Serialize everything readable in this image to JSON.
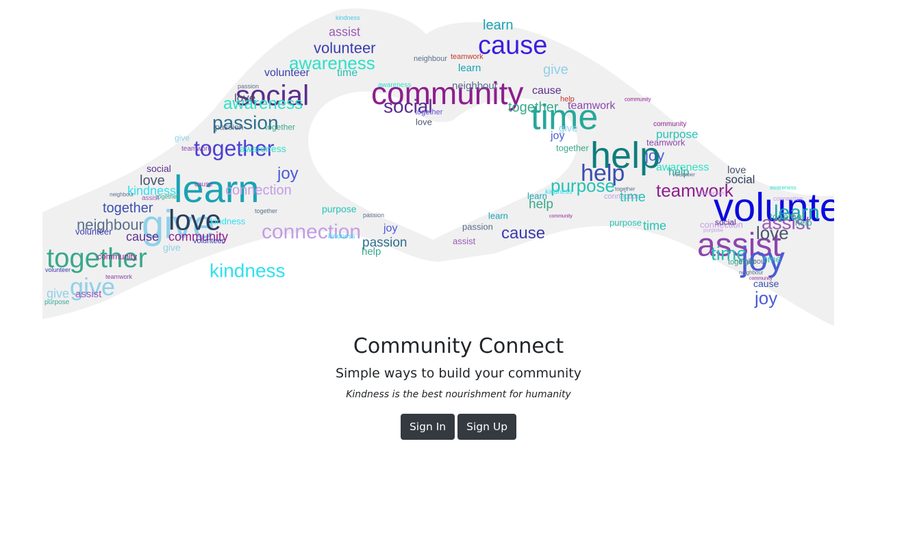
{
  "hero": {
    "image_alt": "Word cloud shaped like two hands forming a heart",
    "background_color": "#f0f0f0",
    "words": [
      {
        "text": "kindness",
        "color": "#48c9e6",
        "size": 9
      },
      {
        "text": "assist",
        "color": "#9b59b6",
        "size": 18
      },
      {
        "text": "volunteer",
        "color": "#3b3bb0",
        "size": 22
      },
      {
        "text": "awareness",
        "color": "#2fe0c6",
        "size": 26
      },
      {
        "text": "neighbour",
        "color": "#5a6e8c",
        "size": 11
      },
      {
        "text": "volunteer",
        "color": "#3b3bb0",
        "size": 16
      },
      {
        "text": "time",
        "color": "#26c2b5",
        "size": 16
      },
      {
        "text": "social",
        "color": "#5b2d8e",
        "size": 42
      },
      {
        "text": "community",
        "color": "#8e1e8e",
        "size": 46
      },
      {
        "text": "awareness",
        "color": "#2fe0c6",
        "size": 10
      },
      {
        "text": "social",
        "color": "#5b2d8e",
        "size": 28
      },
      {
        "text": "passion",
        "color": "#5a6e8c",
        "size": 9
      },
      {
        "text": "love",
        "color": "#4a5570",
        "size": 17
      },
      {
        "text": "awareness",
        "color": "#2fe0c6",
        "size": 24
      },
      {
        "text": "passion",
        "color": "#2e6f8e",
        "size": 28
      },
      {
        "text": "together",
        "color": "#5e50d8",
        "size": 11
      },
      {
        "text": "love",
        "color": "#4a5570",
        "size": 13
      },
      {
        "text": "passion",
        "color": "#5a6e8c",
        "size": 12
      },
      {
        "text": "together",
        "color": "#3aa88a",
        "size": 12
      },
      {
        "text": "together",
        "color": "#4a3fd6",
        "size": 32
      },
      {
        "text": "give",
        "color": "#90d0ea",
        "size": 12
      },
      {
        "text": "teamwork",
        "color": "#8e44ad",
        "size": 10
      },
      {
        "text": "learn",
        "color": "#19a3b4",
        "size": 56
      },
      {
        "text": "awareness",
        "color": "#2fe0c6",
        "size": 14
      },
      {
        "text": "joy",
        "color": "#4a5bd6",
        "size": 24
      },
      {
        "text": "social",
        "color": "#5b2d8e",
        "size": 14
      },
      {
        "text": "love",
        "color": "#4a5570",
        "size": 20
      },
      {
        "text": "cause",
        "color": "#8e44ad",
        "size": 10
      },
      {
        "text": "kindness",
        "color": "#2fe0ef",
        "size": 18
      },
      {
        "text": "connection",
        "color": "#c39ce6",
        "size": 20
      },
      {
        "text": "neighbour",
        "color": "#5a6e8c",
        "size": 8
      },
      {
        "text": "assist",
        "color": "#9b59b6",
        "size": 10
      },
      {
        "text": "together",
        "color": "#3a4eb0",
        "size": 20
      },
      {
        "text": "together",
        "color": "#3aa88a",
        "size": 9
      },
      {
        "text": "give",
        "color": "#90d0ea",
        "size": 58
      },
      {
        "text": "love",
        "color": "#2d3e5a",
        "size": 42
      },
      {
        "text": "together",
        "color": "#5a6e8c",
        "size": 9
      },
      {
        "text": "neighbour",
        "color": "#5a6e8c",
        "size": 22
      },
      {
        "text": "purpose",
        "color": "#26c2b5",
        "size": 14
      },
      {
        "text": "kindness",
        "color": "#2fe0ef",
        "size": 13
      },
      {
        "text": "passion",
        "color": "#5a6e8c",
        "size": 9
      },
      {
        "text": "connection",
        "color": "#c39ce6",
        "size": 30
      },
      {
        "text": "joy",
        "color": "#4a5bd6",
        "size": 16
      },
      {
        "text": "volunteer",
        "color": "#3b3bb0",
        "size": 13
      },
      {
        "text": "cause",
        "color": "#5b2d8e",
        "size": 18
      },
      {
        "text": "community",
        "color": "#8e1e8e",
        "size": 18
      },
      {
        "text": "together",
        "color": "#3aa88a",
        "size": 40
      },
      {
        "text": "volunteer",
        "color": "#3b3bb0",
        "size": 11
      },
      {
        "text": "kindness",
        "color": "#2fe0ef",
        "size": 10
      },
      {
        "text": "give",
        "color": "#90d0ea",
        "size": 14
      },
      {
        "text": "passion",
        "color": "#2e6f8e",
        "size": 19
      },
      {
        "text": "community",
        "color": "#8e1e8e",
        "size": 12
      },
      {
        "text": "help",
        "color": "#3aa88a",
        "size": 15
      },
      {
        "text": "kindness",
        "color": "#2fe0ef",
        "size": 28
      },
      {
        "text": "volunteer",
        "color": "#3b3bb0",
        "size": 9
      },
      {
        "text": "give",
        "color": "#90d0ea",
        "size": 36
      },
      {
        "text": "give",
        "color": "#90d0ea",
        "size": 18
      },
      {
        "text": "teamwork",
        "color": "#8e44ad",
        "size": 9
      },
      {
        "text": "assist",
        "color": "#9b59b6",
        "size": 15
      },
      {
        "text": "purpose",
        "color": "#3aa88a",
        "size": 10
      },
      {
        "text": "learn",
        "color": "#19a3b4",
        "size": 20
      },
      {
        "text": "cause",
        "color": "#3b1fe0",
        "size": 38
      },
      {
        "text": "teamwork",
        "color": "#c0392b",
        "size": 11
      },
      {
        "text": "learn",
        "color": "#19a3b4",
        "size": 15
      },
      {
        "text": "give",
        "color": "#90d0ea",
        "size": 20
      },
      {
        "text": "neighbour",
        "color": "#5a6e8c",
        "size": 15
      },
      {
        "text": "cause",
        "color": "#5b2d8e",
        "size": 16
      },
      {
        "text": "together",
        "color": "#3aa88a",
        "size": 20
      },
      {
        "text": "help",
        "color": "#c0392b",
        "size": 11
      },
      {
        "text": "teamwork",
        "color": "#8e44ad",
        "size": 16
      },
      {
        "text": "community",
        "color": "#8e1e8e",
        "size": 8
      },
      {
        "text": "time",
        "color": "#26a89a",
        "size": 52
      },
      {
        "text": "joy",
        "color": "#4a5bd6",
        "size": 16
      },
      {
        "text": "give",
        "color": "#90d0ea",
        "size": 15
      },
      {
        "text": "community",
        "color": "#8e1e8e",
        "size": 10
      },
      {
        "text": "purpose",
        "color": "#26c2b5",
        "size": 17
      },
      {
        "text": "teamwork",
        "color": "#8e44ad",
        "size": 13
      },
      {
        "text": "joy",
        "color": "#4a5bd6",
        "size": 22
      },
      {
        "text": "together",
        "color": "#3aa88a",
        "size": 13
      },
      {
        "text": "help",
        "color": "#0e7d7d",
        "size": 54
      },
      {
        "text": "help",
        "color": "#3a4eb0",
        "size": 34
      },
      {
        "text": "help",
        "color": "#26a89a",
        "size": 16
      },
      {
        "text": "love",
        "color": "#4a5570",
        "size": 15
      },
      {
        "text": "purpose",
        "color": "#26c2b5",
        "size": 26
      },
      {
        "text": "teamwork",
        "color": "#8e1e8e",
        "size": 26
      },
      {
        "text": "kindness",
        "color": "#2fe0ef",
        "size": 10
      },
      {
        "text": "volunteer",
        "color": "#5a6e8c",
        "size": 8
      },
      {
        "text": "awareness",
        "color": "#2fe0c6",
        "size": 16
      },
      {
        "text": "social",
        "color": "#2d3e5a",
        "size": 17
      },
      {
        "text": "learn",
        "color": "#19a3b4",
        "size": 13
      },
      {
        "text": "together",
        "color": "#5a6e8c",
        "size": 8
      },
      {
        "text": "connection",
        "color": "#c39ce6",
        "size": 8
      },
      {
        "text": "awareness",
        "color": "#2fe0c6",
        "size": 8
      },
      {
        "text": "connection",
        "color": "#c39ce6",
        "size": 11
      },
      {
        "text": "time",
        "color": "#26c2b5",
        "size": 20
      },
      {
        "text": "volunteer",
        "color": "#0a0ae0",
        "size": 58
      },
      {
        "text": "help",
        "color": "#3aa88a",
        "size": 19
      },
      {
        "text": "community",
        "color": "#8e1e8e",
        "size": 7
      },
      {
        "text": "learn",
        "color": "#19a3b4",
        "size": 30
      },
      {
        "text": "connection",
        "color": "#c39ce6",
        "size": 9
      },
      {
        "text": "assist",
        "color": "#9b59b6",
        "size": 28
      },
      {
        "text": "learn",
        "color": "#19a3b4",
        "size": 13
      },
      {
        "text": "cause",
        "color": "#3b3bb0",
        "size": 24
      },
      {
        "text": "passion",
        "color": "#5a6e8c",
        "size": 13
      },
      {
        "text": "assist",
        "color": "#9b59b6",
        "size": 13
      },
      {
        "text": "purpose",
        "color": "#26c2b5",
        "size": 13
      },
      {
        "text": "time",
        "color": "#26c2b5",
        "size": 18
      },
      {
        "text": "connection",
        "color": "#c39ce6",
        "size": 13
      },
      {
        "text": "social",
        "color": "#5b2d8e",
        "size": 12
      },
      {
        "text": "help",
        "color": "#26a89a",
        "size": 13
      },
      {
        "text": "assist",
        "color": "#8e44ad",
        "size": 48
      },
      {
        "text": "time",
        "color": "#26c2b5",
        "size": 28
      },
      {
        "text": "neighbour",
        "color": "#5a6e8c",
        "size": 11
      },
      {
        "text": "purpose",
        "color": "#c39ce6",
        "size": 8
      },
      {
        "text": "love",
        "color": "#4a5570",
        "size": 26
      },
      {
        "text": "together",
        "color": "#3aa88a",
        "size": 14
      },
      {
        "text": "joy",
        "color": "#4a5bd6",
        "size": 50
      },
      {
        "text": "together",
        "color": "#3aa88a",
        "size": 11
      },
      {
        "text": "time",
        "color": "#26c2b5",
        "size": 14
      },
      {
        "text": "neighbour",
        "color": "#5a6e8c",
        "size": 8
      },
      {
        "text": "community",
        "color": "#8e1e8e",
        "size": 7
      },
      {
        "text": "joy",
        "color": "#4a5bd6",
        "size": 26
      },
      {
        "text": "cause",
        "color": "#3a4eb0",
        "size": 14
      }
    ]
  },
  "brand": {
    "title": "Community Connect",
    "subtitle": "Simple ways to build your community",
    "tagline": "Kindness is the best nourishment for humanity"
  },
  "actions": {
    "sign_in_label": "Sign In",
    "sign_up_label": "Sign Up"
  }
}
